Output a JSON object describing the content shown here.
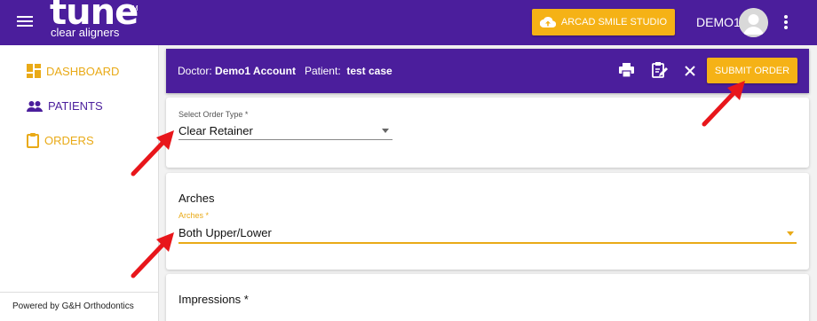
{
  "topbar": {
    "logo_main": "tune",
    "logo_tm": "TM",
    "logo_sub": "clear aligners",
    "arcad_button": "ARCAD SMILE STUDIO",
    "user_name": "DEMO1"
  },
  "sidebar": {
    "items": [
      {
        "label": "DASHBOARD",
        "icon": "dashboard-icon"
      },
      {
        "label": "PATIENTS",
        "icon": "people-icon"
      },
      {
        "label": "ORDERS",
        "icon": "clipboard-icon"
      }
    ],
    "powered_by": "Powered by G&H Orthodontics"
  },
  "order_header": {
    "doctor_label": "Doctor:",
    "doctor_name": "Demo1 Account",
    "patient_label": "Patient:",
    "patient_name": "test case",
    "submit_label": "SUBMIT ORDER",
    "icons": [
      "print-icon",
      "edit-notes-icon",
      "close-icon"
    ]
  },
  "order_type": {
    "label": "Select Order Type *",
    "value": "Clear Retainer"
  },
  "arches": {
    "title": "Arches",
    "label": "Arches *",
    "value": "Both Upper/Lower"
  },
  "impressions": {
    "title": "Impressions *"
  },
  "colors": {
    "primary_purple": "#4b1e9c",
    "accent_gold": "#f5b216",
    "annotation_red": "#e8161b"
  }
}
